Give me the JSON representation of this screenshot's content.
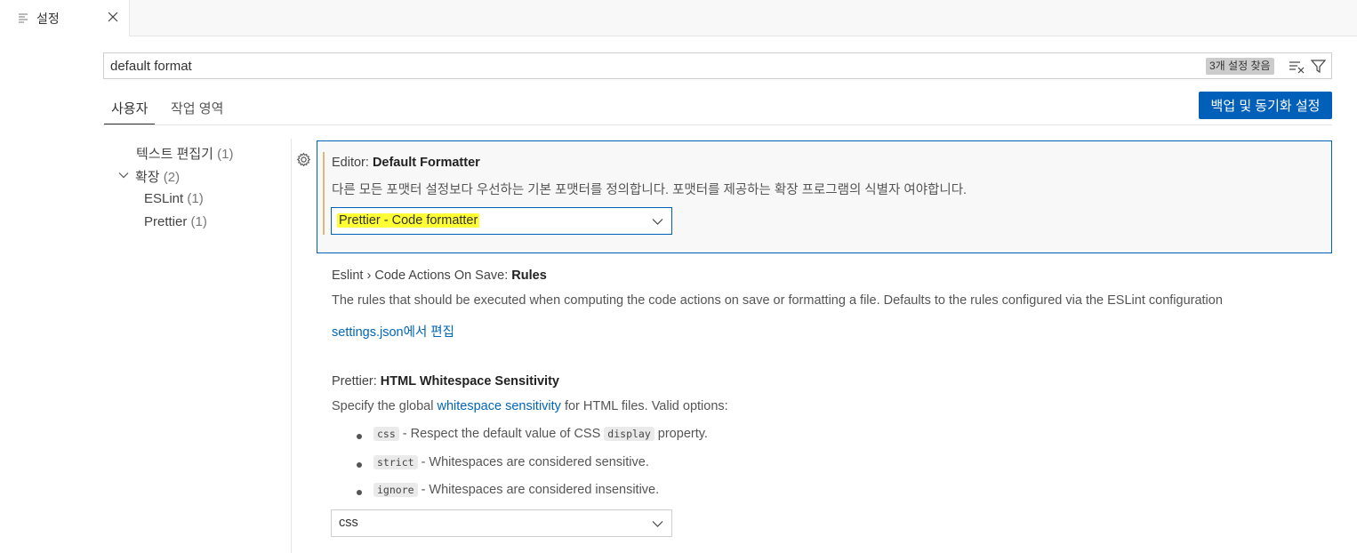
{
  "tab": {
    "label": "설정"
  },
  "search": {
    "value": "default format",
    "result_count": "3개 설정 찾음"
  },
  "scope_tabs": {
    "user": "사용자",
    "workspace": "작업 영역"
  },
  "sync_button": "백업 및 동기화 설정",
  "toc": {
    "text_editor": {
      "label": "텍스트 편집기",
      "count": "(1)"
    },
    "extensions": {
      "label": "확장",
      "count": "(2)"
    },
    "eslint": {
      "label": "ESLint",
      "count": "(1)"
    },
    "prettier": {
      "label": "Prettier",
      "count": "(1)"
    }
  },
  "settings": {
    "default_formatter": {
      "category": "Editor: ",
      "name": "Default Formatter",
      "description": "다른 모든 포맷터 설정보다 우선하는 기본 포맷터를 정의합니다. 포맷터를 제공하는 확장 프로그램의 식별자 여야합니다.",
      "value": "Prettier - Code formatter"
    },
    "eslint_rules": {
      "category": "Eslint › Code Actions On Save: ",
      "name": "Rules",
      "description": "The rules that should be executed when computing the code actions on save or formatting a file. Defaults to the rules configured via the ESLint configuration",
      "edit_link": "settings.json에서 편집"
    },
    "prettier_html": {
      "category": "Prettier: ",
      "name": "HTML Whitespace Sensitivity",
      "desc_before": "Specify the global ",
      "desc_link": "whitespace sensitivity",
      "desc_after": " for HTML files. Valid options:",
      "options": [
        {
          "code": "css",
          "text_before": " - Respect the default value of CSS ",
          "code2": "display",
          "text_after": " property."
        },
        {
          "code": "strict",
          "text": " - Whitespaces are considered sensitive."
        },
        {
          "code": "ignore",
          "text": " - Whitespaces are considered insensitive."
        }
      ],
      "value": "css"
    }
  },
  "colors": {
    "accent": "#005fb8",
    "highlight": "#ffff36",
    "modified": "#dcb67a"
  }
}
